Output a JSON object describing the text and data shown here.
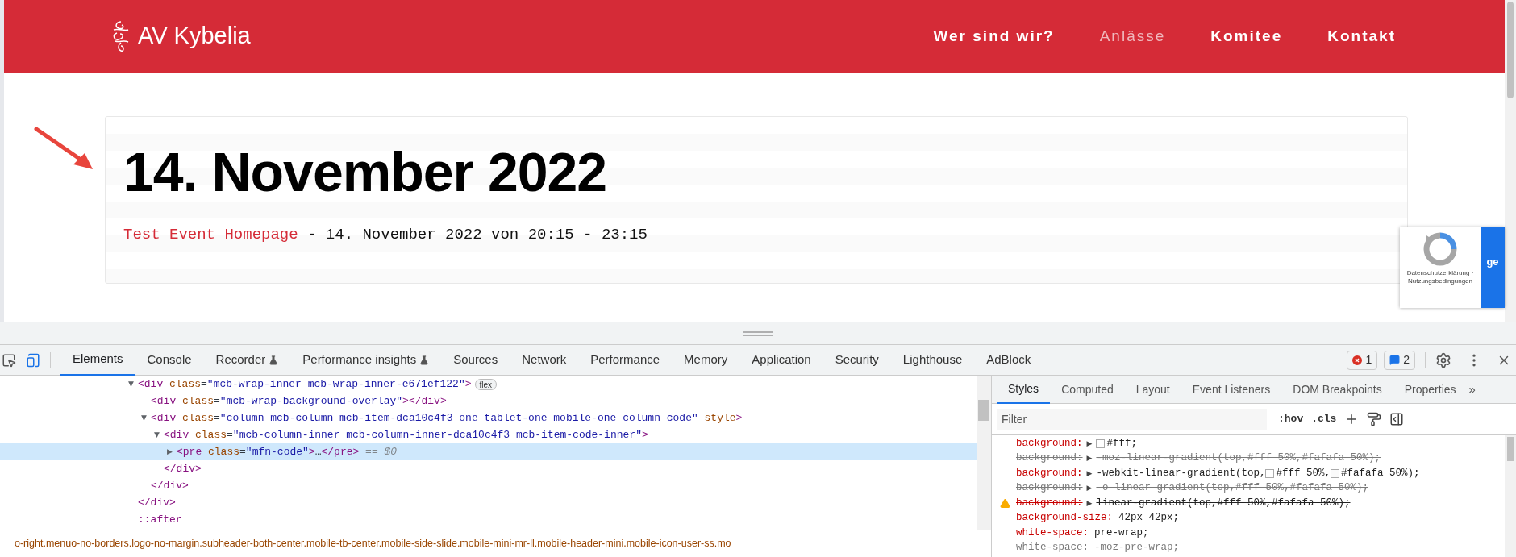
{
  "site": {
    "brand": "AV Kybelia",
    "nav": [
      {
        "label": "Wer sind wir?",
        "selected": false
      },
      {
        "label": "Anlässe",
        "selected": true
      },
      {
        "label": "Komitee",
        "selected": false
      },
      {
        "label": "Kontakt",
        "selected": false
      }
    ],
    "event": {
      "date": "14. November 2022",
      "link": "Test Event Homepage",
      "details": "- 14. November 2022 von 20:15 - 23:15"
    },
    "recaptcha": {
      "label": "ge",
      "sub": "-",
      "footer": "Datenschutzerklärung · Nutzungsbedingungen"
    }
  },
  "devtools": {
    "tabs": [
      {
        "label": "Elements",
        "selected": true,
        "experimental": false
      },
      {
        "label": "Console",
        "selected": false,
        "experimental": false
      },
      {
        "label": "Recorder",
        "selected": false,
        "experimental": true
      },
      {
        "label": "Performance insights",
        "selected": false,
        "experimental": true
      },
      {
        "label": "Sources",
        "selected": false,
        "experimental": false
      },
      {
        "label": "Network",
        "selected": false,
        "experimental": false
      },
      {
        "label": "Performance",
        "selected": false,
        "experimental": false
      },
      {
        "label": "Memory",
        "selected": false,
        "experimental": false
      },
      {
        "label": "Application",
        "selected": false,
        "experimental": false
      },
      {
        "label": "Security",
        "selected": false,
        "experimental": false
      },
      {
        "label": "Lighthouse",
        "selected": false,
        "experimental": false
      },
      {
        "label": "AdBlock",
        "selected": false,
        "experimental": false
      }
    ],
    "issues": {
      "errors": "1",
      "messages": "2"
    },
    "dom": [
      {
        "arrow": "▼",
        "selected": false,
        "badge": "flex",
        "open": [
          {
            "kind": "tag",
            "text": "<div"
          },
          {
            "kind": "attr",
            "text": " class"
          },
          {
            "kind": "plain",
            "text": "="
          },
          {
            "kind": "value",
            "text": "\"mcb-wrap-inner mcb-wrap-inner-e671ef122\""
          },
          {
            "kind": "tag",
            "text": ">"
          }
        ],
        "close": [
          {
            "kind": "tag",
            "text": "</div>"
          }
        ],
        "children": [
          {
            "selected": false,
            "open": [
              {
                "kind": "tag",
                "text": "<div"
              },
              {
                "kind": "attr",
                "text": " class"
              },
              {
                "kind": "plain",
                "text": "="
              },
              {
                "kind": "value",
                "text": "\"mcb-wrap-background-overlay\""
              },
              {
                "kind": "tag",
                "text": "></div>"
              }
            ]
          },
          {
            "arrow": "▼",
            "selected": false,
            "open": [
              {
                "kind": "tag",
                "text": "<div"
              },
              {
                "kind": "attr",
                "text": " class"
              },
              {
                "kind": "plain",
                "text": "="
              },
              {
                "kind": "value",
                "text": "\"column mcb-column mcb-item-dca10c4f3 one tablet-one mobile-one column_code\""
              },
              {
                "kind": "attr",
                "text": " style"
              },
              {
                "kind": "tag",
                "text": ">"
              }
            ],
            "close": [
              {
                "kind": "tag",
                "text": "</div>"
              }
            ],
            "children": [
              {
                "arrow": "▼",
                "selected": false,
                "open": [
                  {
                    "kind": "tag",
                    "text": "<div"
                  },
                  {
                    "kind": "attr",
                    "text": " class"
                  },
                  {
                    "kind": "plain",
                    "text": "="
                  },
                  {
                    "kind": "value",
                    "text": "\"mcb-column-inner mcb-column-inner-dca10c4f3 mcb-item-code-inner\""
                  },
                  {
                    "kind": "tag",
                    "text": ">"
                  }
                ],
                "close": [
                  {
                    "kind": "tag",
                    "text": "</div>"
                  }
                ],
                "children": [
                  {
                    "arrow": "▶",
                    "selected": true,
                    "open": [
                      {
                        "kind": "tag",
                        "text": "<pre"
                      },
                      {
                        "kind": "attr",
                        "text": " class"
                      },
                      {
                        "kind": "plain",
                        "text": "="
                      },
                      {
                        "kind": "value",
                        "text": "\"mfn-code\""
                      },
                      {
                        "kind": "tag",
                        "text": ">"
                      },
                      {
                        "kind": "plain",
                        "text": "…"
                      },
                      {
                        "kind": "tag",
                        "text": "</pre>"
                      },
                      {
                        "kind": "meta",
                        "text": " == $0"
                      }
                    ]
                  }
                ]
              }
            ]
          }
        ]
      },
      {
        "selected": false,
        "open": [
          {
            "kind": "pseudo",
            "text": "::after"
          }
        ]
      }
    ],
    "breadcrumb": "o-right.menuo-no-borders.logo-no-margin.subheader-both-center.mobile-tb-center.mobile-side-slide.mobile-mini-mr-ll.mobile-header-mini.mobile-icon-user-ss.mo",
    "styles": {
      "tabs": [
        {
          "label": "Styles",
          "selected": true
        },
        {
          "label": "Computed",
          "selected": false
        },
        {
          "label": "Layout",
          "selected": false
        },
        {
          "label": "Event Listeners",
          "selected": false
        },
        {
          "label": "DOM Breakpoints",
          "selected": false
        },
        {
          "label": "Properties",
          "selected": false
        }
      ],
      "more": "»",
      "filter": {
        "placeholder": "Filter"
      },
      "hov": ":hov",
      "cls": ".cls",
      "properties": [
        {
          "name": "background:",
          "arrow": "▶",
          "overridden": true,
          "inactive": false,
          "warning": false,
          "value": [
            {
              "color": "#ffffff",
              "text": "#fff;"
            }
          ]
        },
        {
          "name": "background:",
          "arrow": "▶",
          "overridden": true,
          "inactive": true,
          "warning": false,
          "value": [
            {
              "text": "-moz-linear-gradient(top,#fff 50%,#fafafa 50%);"
            }
          ]
        },
        {
          "name": "background:",
          "arrow": "▶",
          "overridden": false,
          "inactive": false,
          "warning": false,
          "value": [
            {
              "text": "-webkit-linear-gradient(top,"
            },
            {
              "color": "#ffffff",
              "text": "#fff 50%,"
            },
            {
              "color": "#fafafa",
              "text": "#fafafa 50%);"
            }
          ]
        },
        {
          "name": "background:",
          "arrow": "▶",
          "overridden": true,
          "inactive": true,
          "warning": false,
          "value": [
            {
              "text": "-o-linear-gradient(top,#fff 50%,#fafafa 50%);"
            }
          ]
        },
        {
          "name": "background:",
          "arrow": "▶",
          "overridden": true,
          "inactive": false,
          "warning": true,
          "value": [
            {
              "text": "linear-gradient(top,#fff 50%,#fafafa 50%);"
            }
          ]
        },
        {
          "name": "background-size:",
          "overridden": false,
          "inactive": false,
          "warning": false,
          "value": [
            {
              "text": "42px 42px;"
            }
          ]
        },
        {
          "name": "white-space:",
          "overridden": false,
          "inactive": false,
          "warning": false,
          "value": [
            {
              "text": "pre-wrap;"
            }
          ]
        },
        {
          "name": "white-space:",
          "overridden": true,
          "inactive": true,
          "warning": false,
          "value": [
            {
              "text": "-moz-pre-wrap;"
            }
          ]
        }
      ]
    }
  }
}
